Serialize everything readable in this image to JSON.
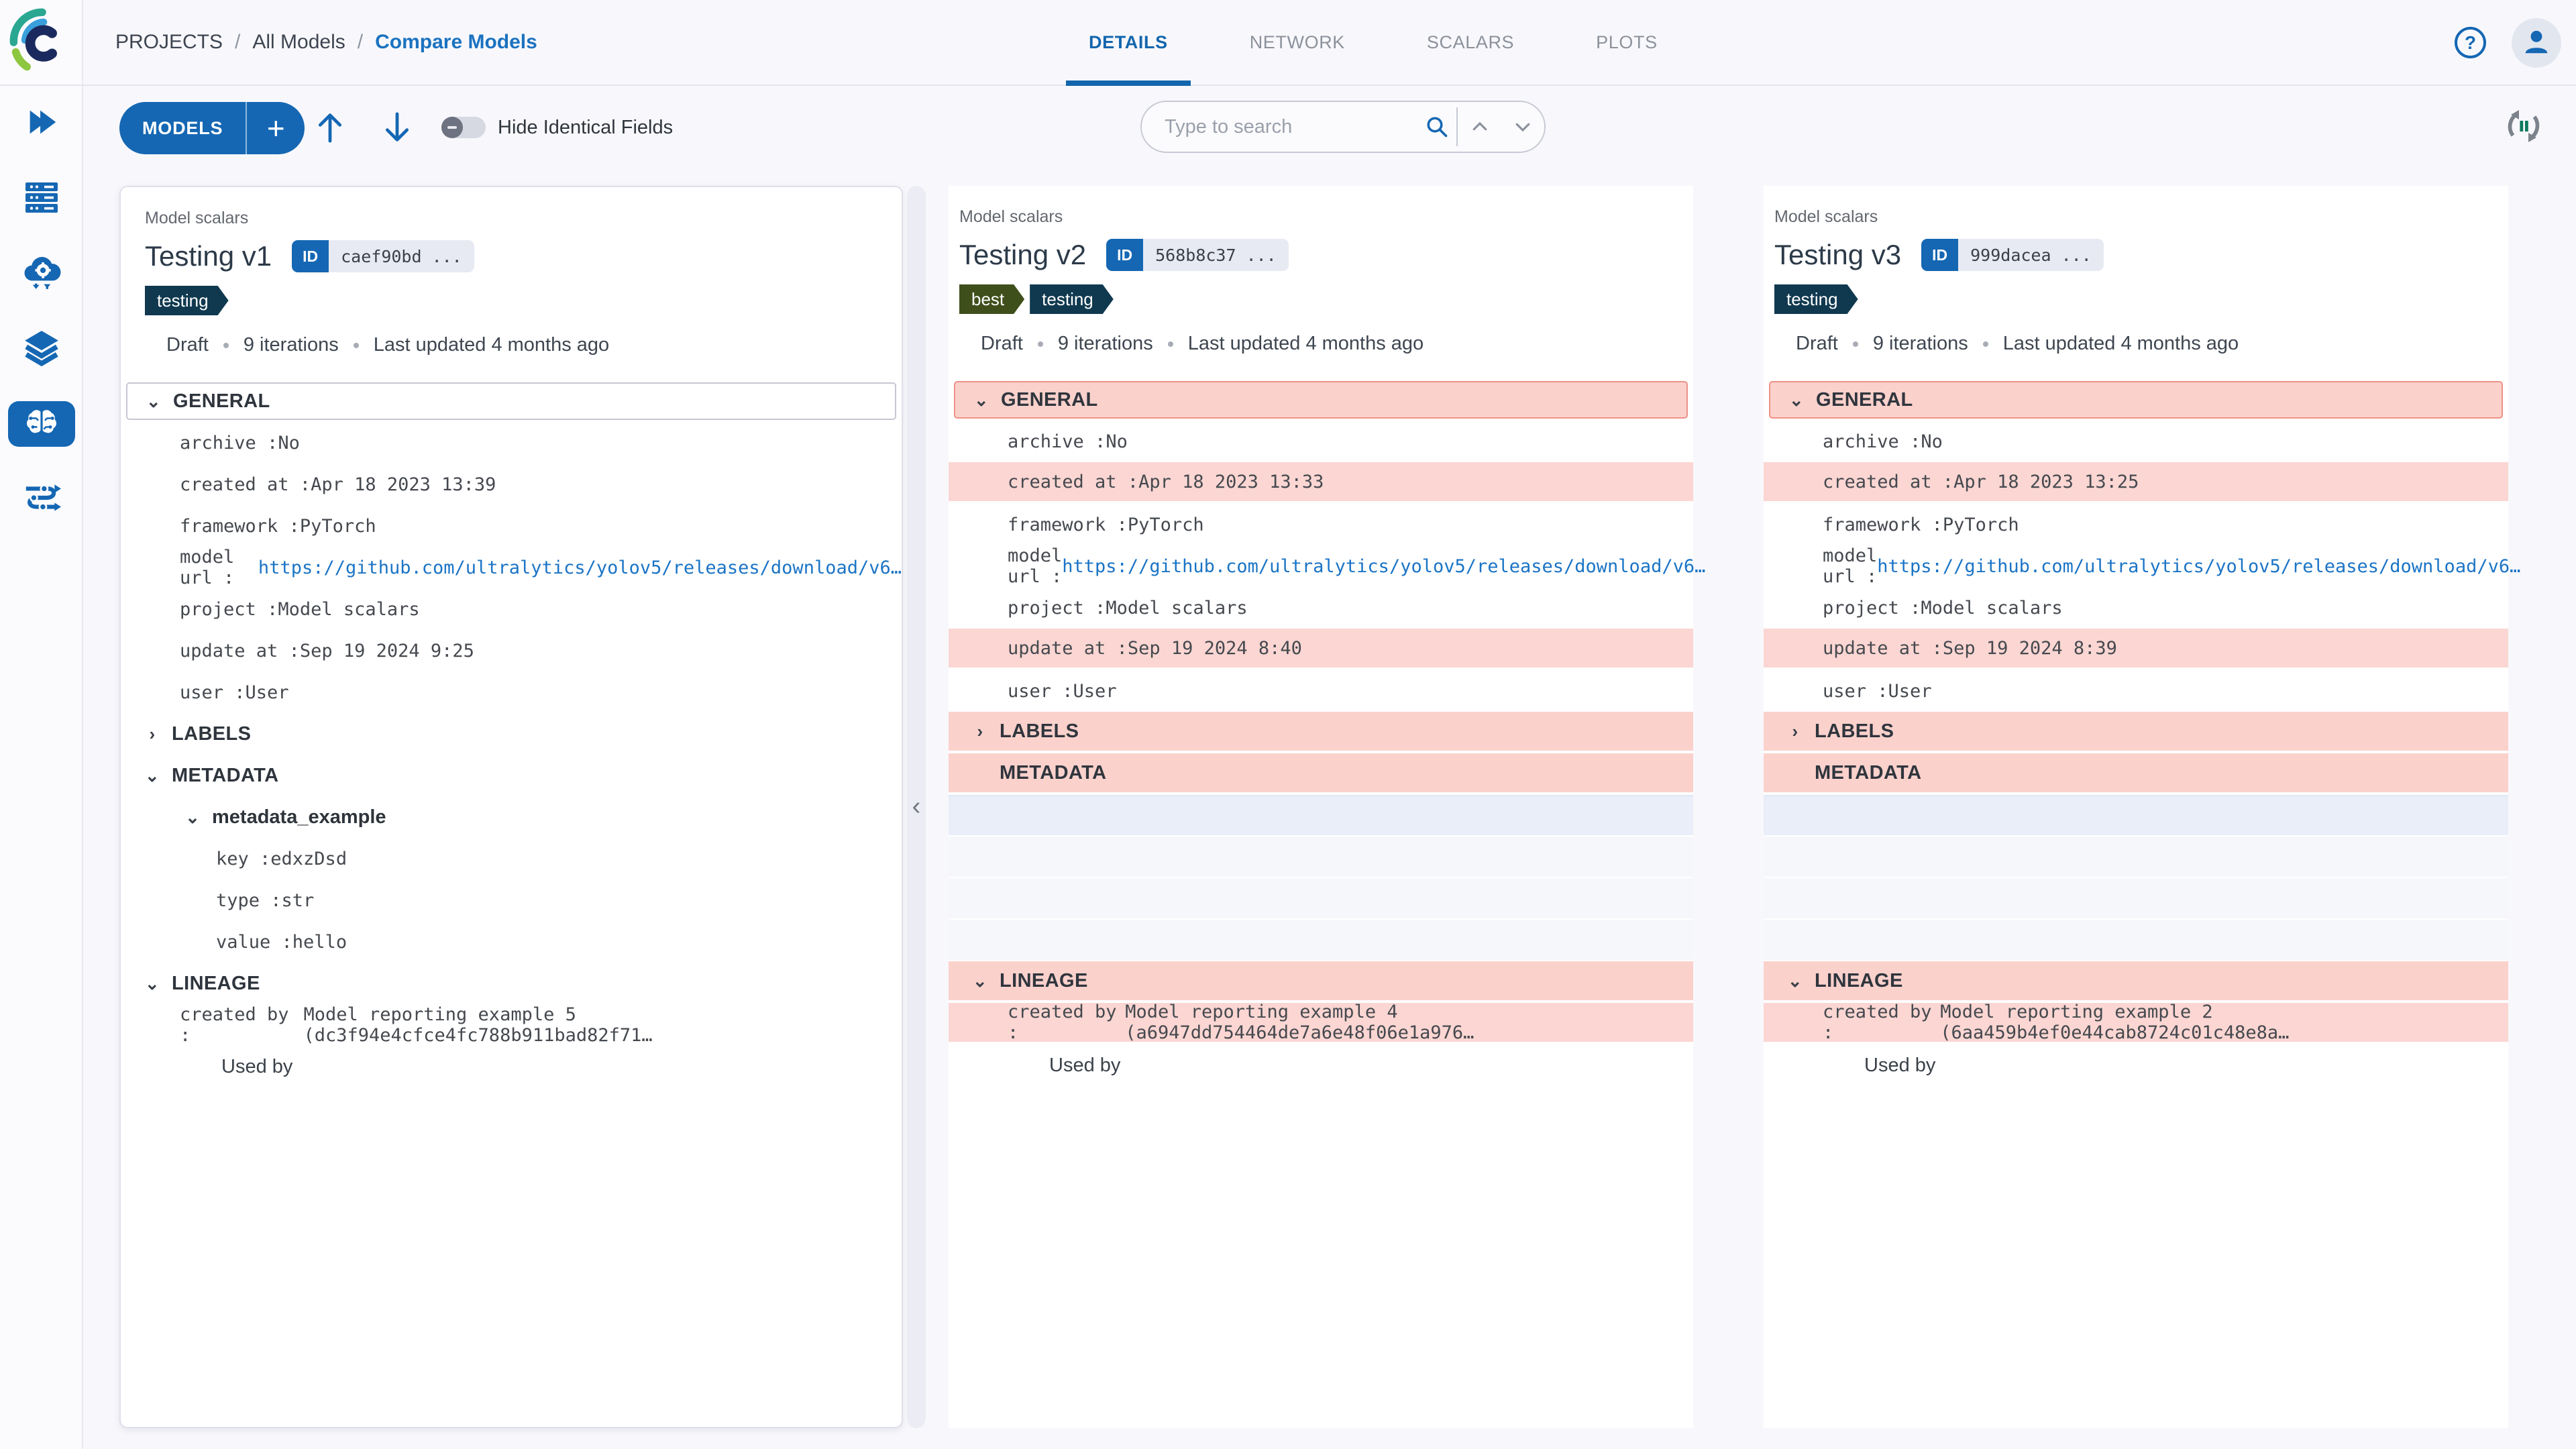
{
  "brand": {
    "name": "ClearML",
    "logo_icon": "clearml-c-logo"
  },
  "colors": {
    "accent_blue": "#1567b3",
    "link_blue": "#1b74c5",
    "diff_row_pink": "#fbd6d2",
    "diff_header_pink": "#fbd1cc",
    "diff_border_salmon": "#ee9287",
    "tag_testing": "#10394f",
    "tag_best": "#3f4f1b"
  },
  "breadcrumb": {
    "items": [
      "PROJECTS",
      "All Models",
      "Compare Models"
    ],
    "separator": "/"
  },
  "tabs": [
    {
      "label": "DETAILS",
      "active": true
    },
    {
      "label": "NETWORK",
      "active": false
    },
    {
      "label": "SCALARS",
      "active": false
    },
    {
      "label": "PLOTS",
      "active": false
    }
  ],
  "topbar_icons": {
    "help": "?",
    "user": "user-avatar"
  },
  "sidebar": {
    "items": [
      "projects",
      "workers-queues",
      "applications",
      "datasets",
      "models",
      "pipelines"
    ],
    "active": "models"
  },
  "toolbar": {
    "models_button": "MODELS",
    "add_button": "+",
    "up_arrow": "↑",
    "down_arrow": "↓",
    "hide_toggle_label": "Hide Identical Fields",
    "hide_toggle_on": false,
    "search_placeholder": "Type to search",
    "refresh_icon": "auto-refresh"
  },
  "divider": {
    "collapse_chevron": "‹"
  },
  "columns": [
    {
      "project_label": "Model scalars",
      "title": "Testing v1",
      "id_badge": {
        "label": "ID",
        "value": "caef90bd ..."
      },
      "tags": [
        {
          "label": "testing",
          "color": "#10394f"
        }
      ],
      "meta": {
        "status": "Draft",
        "iterations": "9 iterations",
        "updated": "Last updated 4 months ago"
      },
      "rows": [
        {
          "kind": "section",
          "label": "GENERAL",
          "chevron": "down",
          "boxed": true
        },
        {
          "kind": "kv",
          "key": "archive",
          "value": "No"
        },
        {
          "kind": "kv",
          "key": "created at",
          "value": "Apr 18 2023 13:39"
        },
        {
          "kind": "kv",
          "key": "framework",
          "value": "PyTorch"
        },
        {
          "kind": "kv",
          "key": "model url",
          "value": "https://github.com/ultralytics/yolov5/releases/download/v6…",
          "link": true
        },
        {
          "kind": "kv",
          "key": "project",
          "value": "Model scalars"
        },
        {
          "kind": "kv",
          "key": "update at",
          "value": "Sep 19 2024 9:25"
        },
        {
          "kind": "kv",
          "key": "user",
          "value": "User"
        },
        {
          "kind": "section",
          "label": "LABELS",
          "chevron": "right"
        },
        {
          "kind": "section",
          "label": "METADATA",
          "chevron": "down"
        },
        {
          "kind": "sub",
          "label": "metadata_example",
          "chevron": "down"
        },
        {
          "kind": "kv2",
          "key": "key",
          "value": "edxzDsd"
        },
        {
          "kind": "kv2",
          "key": "type",
          "value": "str"
        },
        {
          "kind": "kv2",
          "key": "value",
          "value": "hello"
        },
        {
          "kind": "section",
          "label": "LINEAGE",
          "chevron": "down"
        },
        {
          "kind": "kv",
          "key": "created by",
          "value": "Model reporting example 5 (dc3f94e4cfce4fc788b911bad82f71…"
        },
        {
          "kind": "text",
          "label": "Used by"
        }
      ]
    },
    {
      "project_label": "Model scalars",
      "title": "Testing v2",
      "id_badge": {
        "label": "ID",
        "value": "568b8c37 ..."
      },
      "tags": [
        {
          "label": "best",
          "color": "#3f4f1b"
        },
        {
          "label": "testing",
          "color": "#10394f"
        }
      ],
      "meta": {
        "status": "Draft",
        "iterations": "9 iterations",
        "updated": "Last updated 4 months ago"
      },
      "rows": [
        {
          "kind": "section",
          "label": "GENERAL",
          "chevron": "down",
          "boxed": true,
          "diff": true
        },
        {
          "kind": "kv",
          "key": "archive",
          "value": "No"
        },
        {
          "kind": "kv",
          "key": "created at",
          "value": "Apr 18 2023 13:33",
          "diff": true
        },
        {
          "kind": "kv",
          "key": "framework",
          "value": "PyTorch"
        },
        {
          "kind": "kv",
          "key": "model url",
          "value": "https://github.com/ultralytics/yolov5/releases/download/v6…",
          "link": true
        },
        {
          "kind": "kv",
          "key": "project",
          "value": "Model scalars"
        },
        {
          "kind": "kv",
          "key": "update at",
          "value": "Sep 19 2024 8:40",
          "diff": true
        },
        {
          "kind": "kv",
          "key": "user",
          "value": "User"
        },
        {
          "kind": "section",
          "label": "LABELS",
          "chevron": "right",
          "diff": true
        },
        {
          "kind": "section",
          "label": "METADATA",
          "chevron": "none",
          "diff": true
        },
        {
          "kind": "empty",
          "style": "blue"
        },
        {
          "kind": "empty",
          "style": "light"
        },
        {
          "kind": "empty",
          "style": "light"
        },
        {
          "kind": "empty",
          "style": "light"
        },
        {
          "kind": "section",
          "label": "LINEAGE",
          "chevron": "down",
          "diff": true
        },
        {
          "kind": "kv",
          "key": "created by",
          "value": "Model reporting example 4 (a6947dd754464de7a6e48f06e1a976…",
          "diff": true
        },
        {
          "kind": "text",
          "label": "Used by"
        }
      ]
    },
    {
      "project_label": "Model scalars",
      "title": "Testing v3",
      "id_badge": {
        "label": "ID",
        "value": "999dacea ..."
      },
      "tags": [
        {
          "label": "testing",
          "color": "#10394f"
        }
      ],
      "meta": {
        "status": "Draft",
        "iterations": "9 iterations",
        "updated": "Last updated 4 months ago"
      },
      "rows": [
        {
          "kind": "section",
          "label": "GENERAL",
          "chevron": "down",
          "boxed": true,
          "diff": true
        },
        {
          "kind": "kv",
          "key": "archive",
          "value": "No"
        },
        {
          "kind": "kv",
          "key": "created at",
          "value": "Apr 18 2023 13:25",
          "diff": true
        },
        {
          "kind": "kv",
          "key": "framework",
          "value": "PyTorch"
        },
        {
          "kind": "kv",
          "key": "model url",
          "value": "https://github.com/ultralytics/yolov5/releases/download/v6…",
          "link": true
        },
        {
          "kind": "kv",
          "key": "project",
          "value": "Model scalars"
        },
        {
          "kind": "kv",
          "key": "update at",
          "value": "Sep 19 2024 8:39",
          "diff": true
        },
        {
          "kind": "kv",
          "key": "user",
          "value": "User"
        },
        {
          "kind": "section",
          "label": "LABELS",
          "chevron": "right",
          "diff": true
        },
        {
          "kind": "section",
          "label": "METADATA",
          "chevron": "none",
          "diff": true
        },
        {
          "kind": "empty",
          "style": "blue"
        },
        {
          "kind": "empty",
          "style": "light"
        },
        {
          "kind": "empty",
          "style": "light"
        },
        {
          "kind": "empty",
          "style": "light"
        },
        {
          "kind": "section",
          "label": "LINEAGE",
          "chevron": "down",
          "diff": true
        },
        {
          "kind": "kv",
          "key": "created by",
          "value": "Model reporting example 2 (6aa459b4ef0e44cab8724c01c48e8a…",
          "diff": true
        },
        {
          "kind": "text",
          "label": "Used by"
        }
      ]
    }
  ]
}
